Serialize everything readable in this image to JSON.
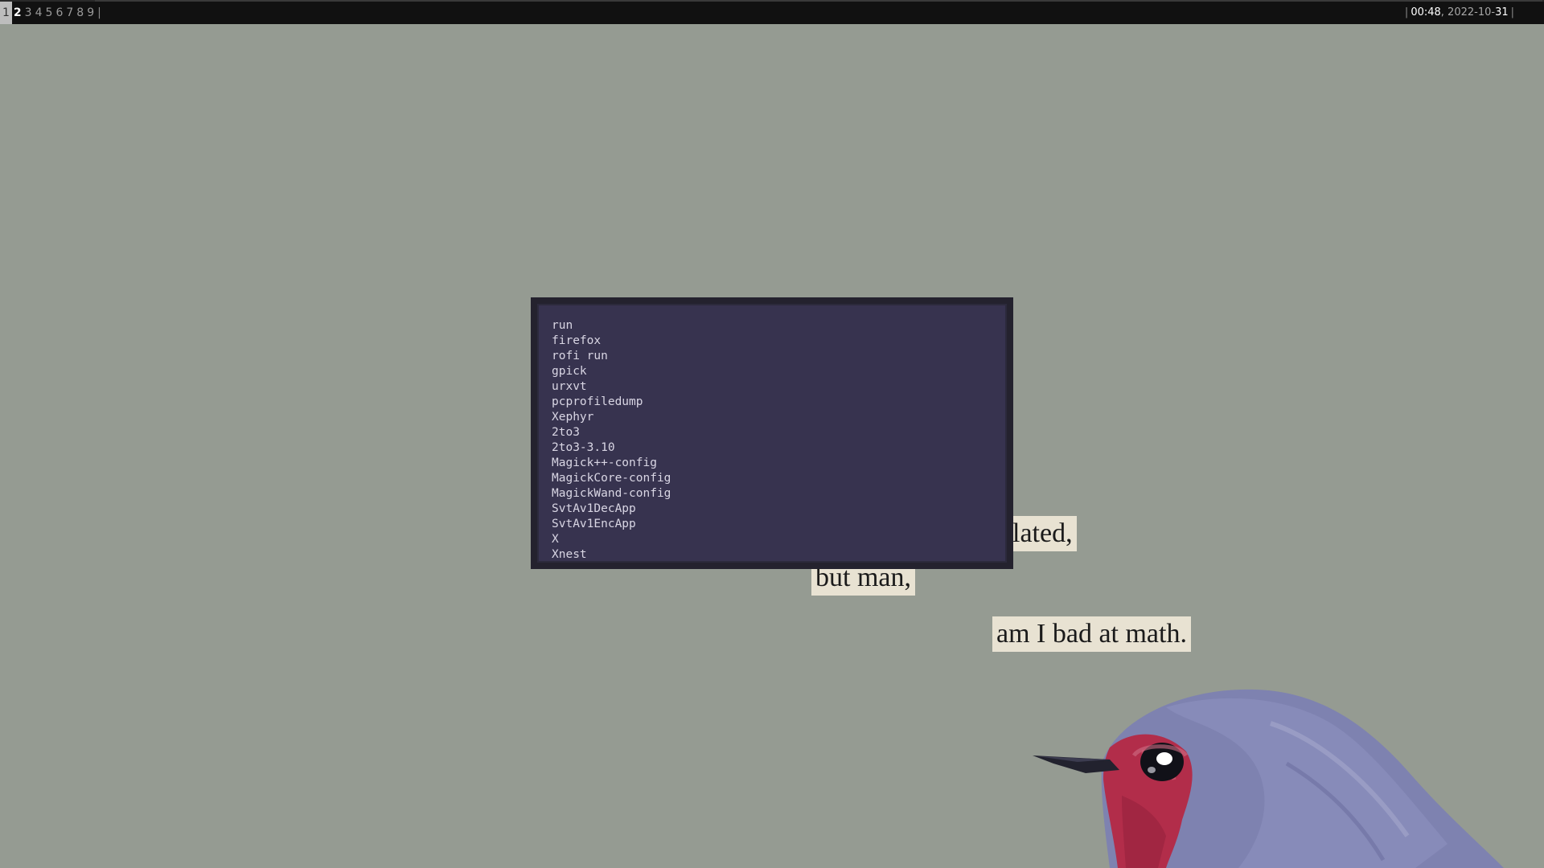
{
  "topbar": {
    "workspaces": [
      {
        "label": "1",
        "state": "first"
      },
      {
        "label": "2",
        "state": "active"
      },
      {
        "label": "3",
        "state": ""
      },
      {
        "label": "4",
        "state": ""
      },
      {
        "label": "5",
        "state": ""
      },
      {
        "label": "6",
        "state": ""
      },
      {
        "label": "7",
        "state": ""
      },
      {
        "label": "8",
        "state": ""
      },
      {
        "label": "9",
        "state": ""
      }
    ],
    "separator": "|",
    "clock": {
      "time": "00:48",
      "date_prefix": "2022-10-",
      "date_day": "31"
    }
  },
  "launcher": {
    "items": [
      "run",
      "firefox",
      "rofi run",
      "gpick",
      "urxvt",
      "pcprofiledump",
      "Xephyr",
      "2to3",
      "2to3-3.10",
      "Magick++-config",
      "MagickCore-config",
      "MagickWand-config",
      "SvtAv1DecApp",
      "SvtAv1EncApp",
      "X",
      "Xnest"
    ]
  },
  "wallpaper": {
    "captions": [
      "lated,",
      "but man,",
      "am I bad at math."
    ],
    "colors": {
      "background": "#959b92",
      "paper": "#e8e2d2",
      "bird_head": "#b22d4a",
      "bird_body": "#7e82b0"
    }
  }
}
